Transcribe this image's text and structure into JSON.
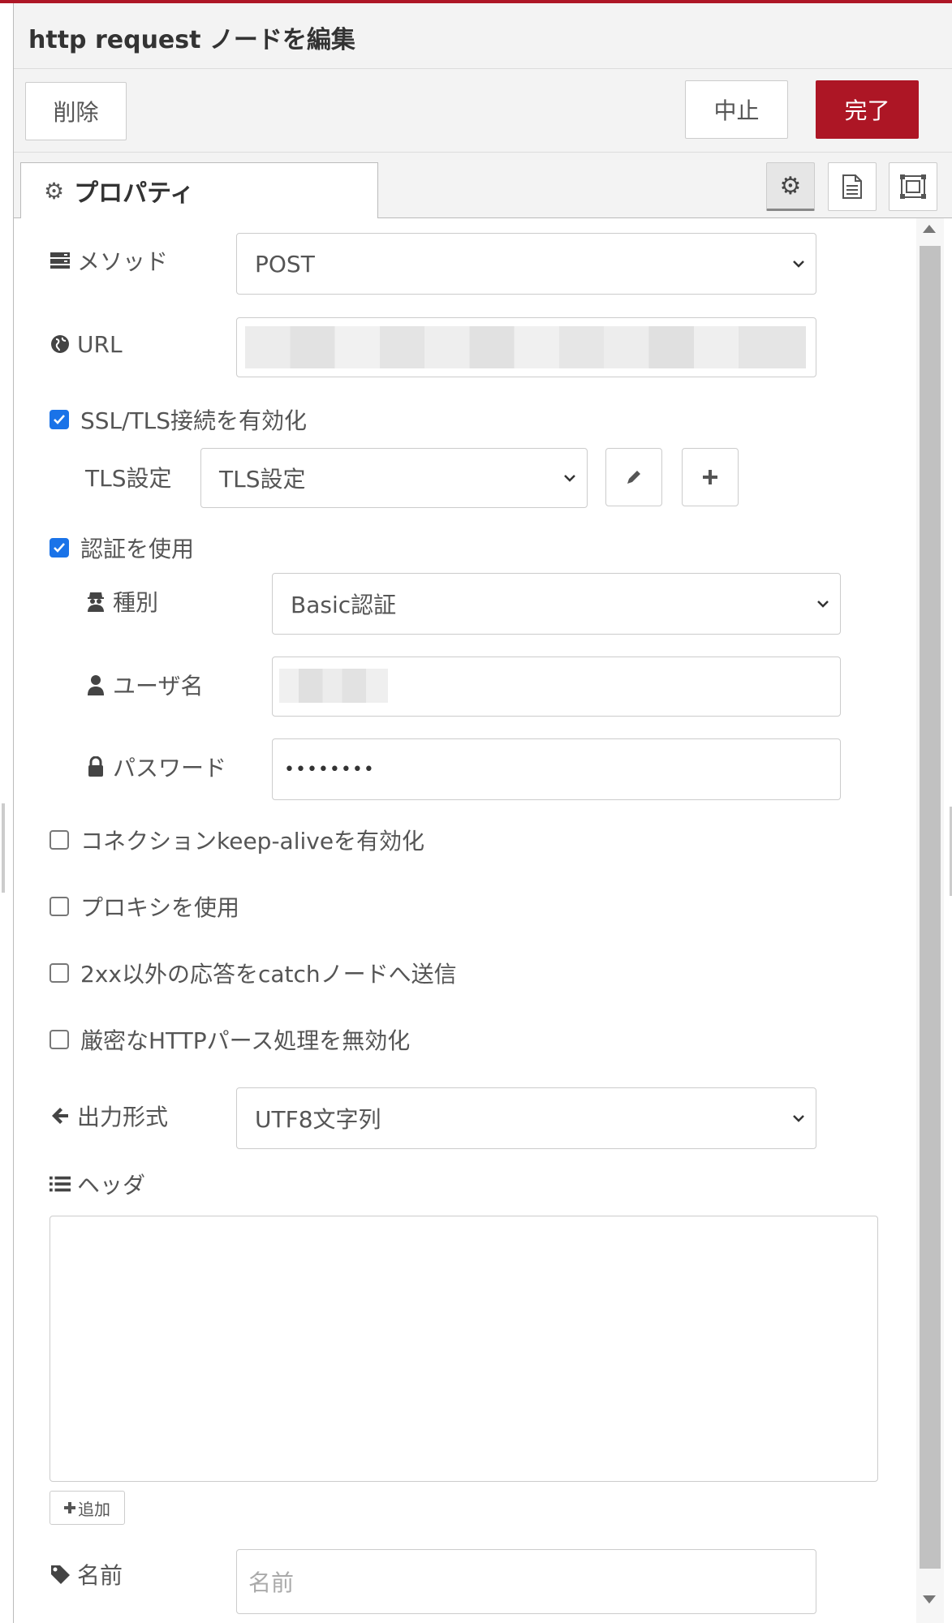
{
  "tray": {
    "title": "http request ノードを編集",
    "delete_label": "削除",
    "cancel_label": "中止",
    "done_label": "完了",
    "accent_color": "#ad1625"
  },
  "tabs": {
    "properties_label": "プロパティ",
    "icons": [
      "gear-icon",
      "description-icon",
      "appearance-icon"
    ]
  },
  "form": {
    "method": {
      "label": "メソッド",
      "value": "POST"
    },
    "url": {
      "label": "URL"
    },
    "ssl": {
      "label": "SSL/TLS接続を有効化",
      "checked": true
    },
    "tls": {
      "label": "TLS設定",
      "value": "TLS設定"
    },
    "auth": {
      "label": "認証を使用",
      "checked": true
    },
    "auth_type": {
      "label": "種別",
      "value": "Basic認証"
    },
    "username": {
      "label": "ユーザ名"
    },
    "password": {
      "label": "パスワード",
      "value": "••••••••"
    },
    "keepalive": {
      "label": "コネクションkeep-aliveを有効化",
      "checked": false
    },
    "proxy": {
      "label": "プロキシを使用",
      "checked": false
    },
    "catch_non2xx": {
      "label": "2xx以外の応答をcatchノードへ送信",
      "checked": false
    },
    "insecure_parser": {
      "label": "厳密なHTTPパース処理を無効化",
      "checked": false
    },
    "output": {
      "label": "出力形式",
      "value": "UTF8文字列"
    },
    "headers": {
      "label": "ヘッダ",
      "add_label": "追加"
    },
    "name": {
      "label": "名前",
      "placeholder": "名前"
    }
  }
}
